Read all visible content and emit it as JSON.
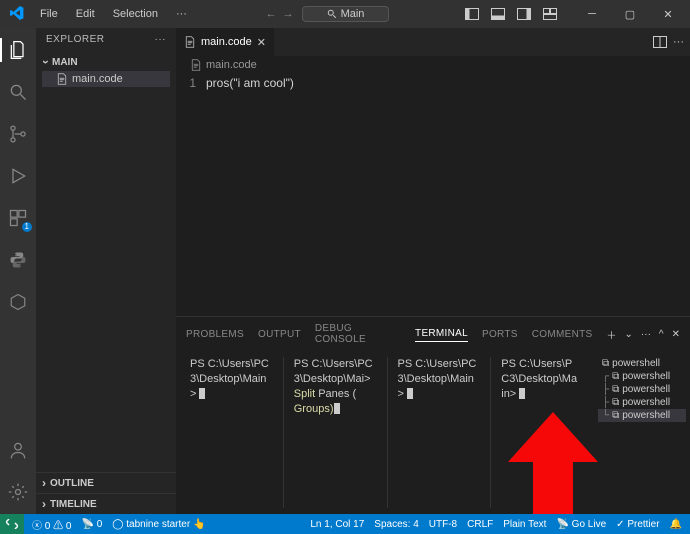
{
  "titlebar": {
    "menus": [
      "File",
      "Edit",
      "Selection",
      "···"
    ],
    "search_label": "Main"
  },
  "sidebar": {
    "title": "EXPLORER",
    "section": "MAIN",
    "file": "main.code",
    "outline": "OUTLINE",
    "timeline": "TIMELINE"
  },
  "tabs": {
    "active": "main.code"
  },
  "breadcrumb": "main.code",
  "code": {
    "line_no": "1",
    "content": "pros(\"i am cool\")"
  },
  "panel": {
    "tabs": [
      "PROBLEMS",
      "OUTPUT",
      "DEBUG CONSOLE",
      "TERMINAL",
      "PORTS",
      "COMMENTS"
    ]
  },
  "terminals": {
    "p1_l1": "PS C:\\Users\\PC",
    "p1_l2": "3\\Desktop\\Main",
    "p1_l3": "> ",
    "p2_l1": "PS C:\\Users\\PC",
    "p2_l2": "3\\Desktop\\Mai>",
    "p2_l3a": " Split",
    "p2_l3b": " Panes (",
    "p2_l4a": " Groups)",
    "p3_l1": "PS C:\\Users\\PC",
    "p3_l2": "3\\Desktop\\Main",
    "p3_l3": "> ",
    "p4_l1": "PS C:\\Users\\P",
    "p4_l2": "C3\\Desktop\\Ma",
    "p4_l3": "in> ",
    "list": [
      "powershell",
      "powershell",
      "powershell",
      "powershell",
      "powershell"
    ]
  },
  "status": {
    "err": "0",
    "warn": "0",
    "ports": "0",
    "tabnine": "tabnine starter",
    "pos": "Ln 1, Col 17",
    "spaces": "Spaces: 4",
    "enc": "UTF-8",
    "eol": "CRLF",
    "lang": "Plain Text",
    "golive": "Go Live",
    "prettier": "Prettier"
  }
}
